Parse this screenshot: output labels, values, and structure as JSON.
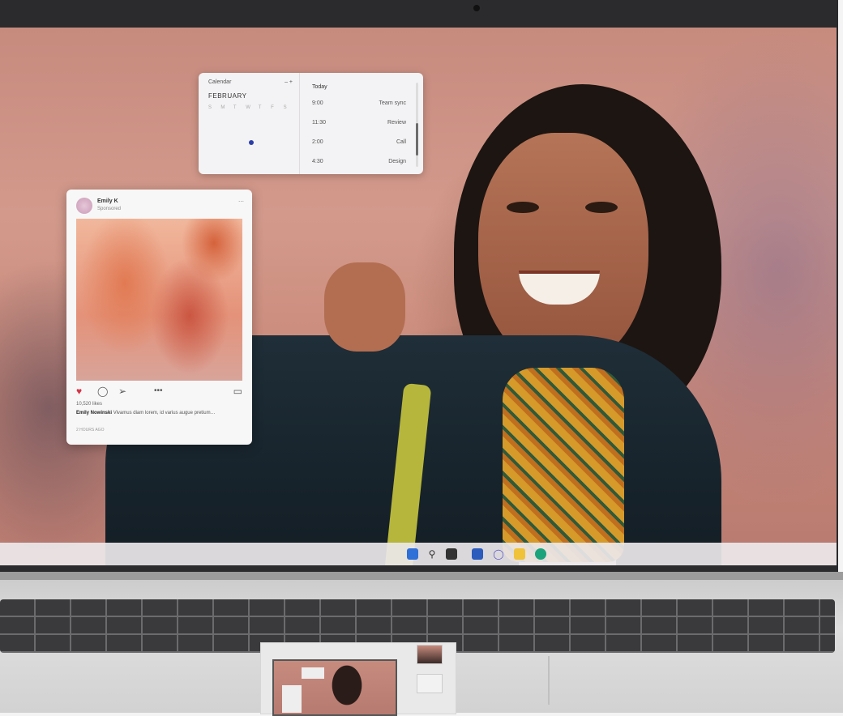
{
  "calendar_widget": {
    "header": "Calendar",
    "controls": "– +",
    "month": "FEBRUARY",
    "weekdays": [
      "S",
      "M",
      "T",
      "W",
      "T",
      "F",
      "S"
    ],
    "agenda_header": "Today",
    "agenda": [
      {
        "time": "9:00",
        "title": "Team sync"
      },
      {
        "time": "11:30",
        "title": "Review"
      },
      {
        "time": "2:00",
        "title": "Call"
      },
      {
        "time": "4:30",
        "title": "Design"
      }
    ]
  },
  "social_post": {
    "username": "Emily K",
    "subtitle": "Sponsored",
    "more": "⋯",
    "likes": "10,520 likes",
    "caption_user": "Emily Nowinski",
    "caption_text": "Vivamus diam lorem, id varius augue pretium…",
    "time": "2 HOURS AGO"
  },
  "taskbar": {
    "icons": [
      "windows-start-icon",
      "search-icon",
      "task-view-icon",
      "widgets-icon",
      "chat-icon",
      "file-explorer-icon",
      "edge-browser-icon"
    ]
  },
  "colors": {
    "accent_blue": "#2b3ea8",
    "like_red": "#d63447",
    "bezel": "#2b2b2d"
  }
}
